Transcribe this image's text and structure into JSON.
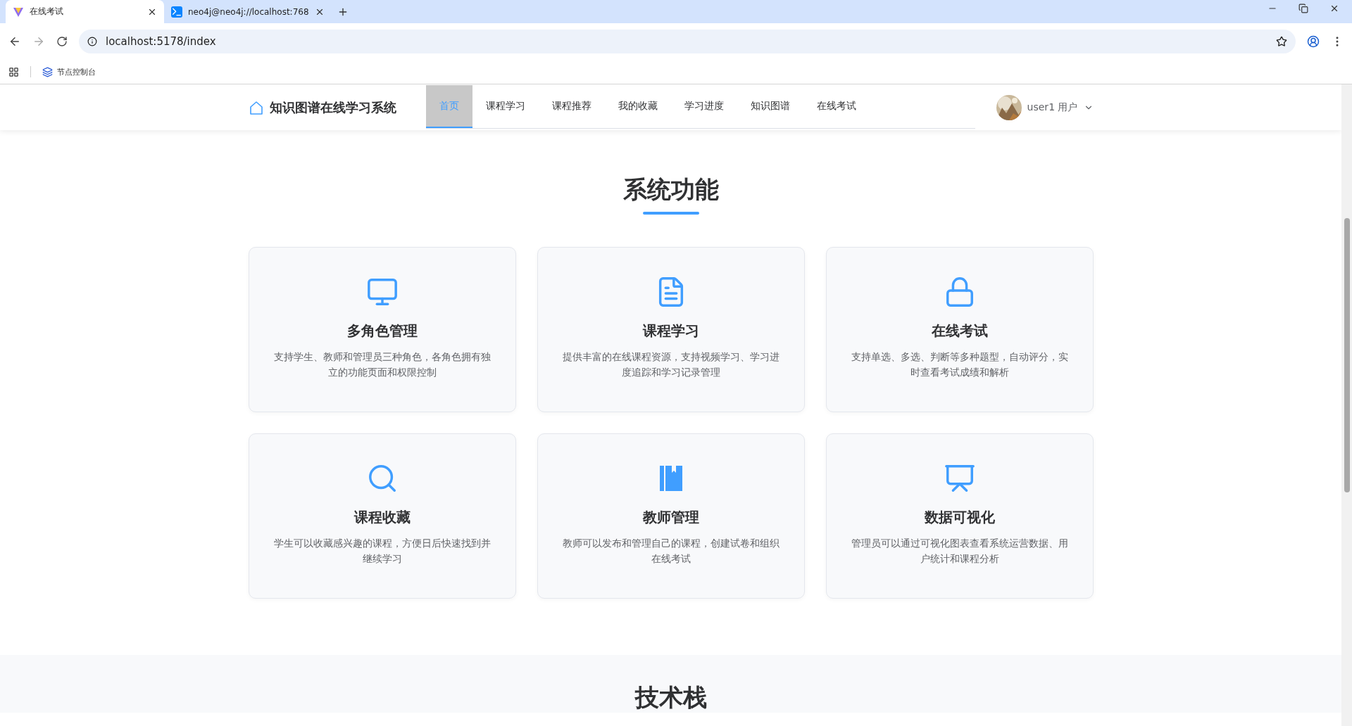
{
  "browser": {
    "tabs": [
      {
        "title": "在线考试",
        "kind": "logo",
        "selected": true
      },
      {
        "title": "neo4j@neo4j://localhost:768",
        "kind": "terminal",
        "selected": false
      }
    ],
    "url": "localhost:5178/index",
    "bookmarks": [
      {
        "label": "节点控制台"
      }
    ]
  },
  "header": {
    "brand": "知识图谱在线学习系统",
    "nav": [
      {
        "label": "首页",
        "selected": true
      },
      {
        "label": "课程学习",
        "selected": false
      },
      {
        "label": "课程推荐",
        "selected": false
      },
      {
        "label": "我的收藏",
        "selected": false
      },
      {
        "label": "学习进度",
        "selected": false
      },
      {
        "label": "知识图谱",
        "selected": false
      },
      {
        "label": "在线考试",
        "selected": false
      }
    ],
    "user": "user1 用户"
  },
  "features": {
    "title": "系统功能",
    "cards": [
      {
        "kind": "monitor",
        "title": "多角色管理",
        "description": "支持学生、教师和管理员三种角色，各角色拥有独立的功能页面和权限控制"
      },
      {
        "kind": "document",
        "title": "课程学习",
        "description": "提供丰富的在线课程资源，支持视频学习、学习进度追踪和学习记录管理"
      },
      {
        "kind": "lock",
        "title": "在线考试",
        "description": "支持单选、多选、判断等多种题型，自动评分，实时查看考试成绩和解析"
      },
      {
        "kind": "search",
        "title": "课程收藏",
        "description": "学生可以收藏感兴趣的课程，方便日后快速找到并继续学习"
      },
      {
        "kind": "book",
        "title": "教师管理",
        "description": "教师可以发布和管理自己的课程，创建试卷和组织在线考试"
      },
      {
        "kind": "chart",
        "title": "数据可视化",
        "description": "管理员可以通过可视化图表查看系统运营数据、用户统计和课程分析"
      }
    ]
  },
  "tech": {
    "title": "技术栈"
  }
}
